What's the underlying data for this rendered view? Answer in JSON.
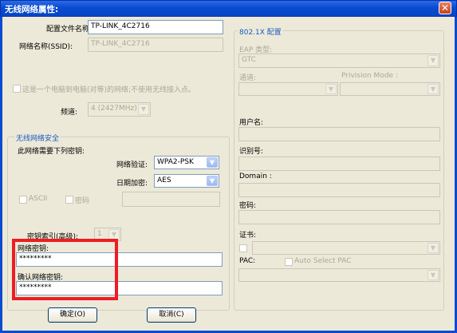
{
  "window": {
    "title": "无线网络属性:",
    "close_glyph": "✕"
  },
  "profile": {
    "config_name_label": "配置文件名称:",
    "config_name_value": "TP-LINK_4C2716",
    "ssid_label": "网络名称(SSID):",
    "ssid_value": "TP-LINK_4C2716"
  },
  "adhoc": {
    "label": "这是一个电脑到电脑(对等)的网络;不使用无线接入点。",
    "channel_label": "频道:",
    "channel_value": "4 (2427MHz)"
  },
  "security": {
    "group_title": "无线网络安全",
    "requires_key_label": "此网络需要下列密钥:",
    "auth_label": "网络验证:",
    "auth_value": "WPA2-PSK",
    "encryption_label": "日期加密:",
    "encryption_value": "AES",
    "ascii_label": "ASCII",
    "password_label": "密码",
    "key_index_label": "密钥索引(高级):",
    "key_index_value": "1",
    "net_key_label": "网络密钥:",
    "net_key_value": "*********",
    "confirm_key_label": "确认网络密钥:",
    "confirm_key_value": "*********"
  },
  "eap_8021x": {
    "group_title": "802.1X 配置",
    "eap_type_label": "EAP 类型:",
    "eap_type_value": "GTC",
    "tunnel_label": "通道:",
    "provision_label": "Privision Mode :",
    "username_label": "用户名:",
    "identity_label": "识别号:",
    "domain_label": "Domain :",
    "password_label": "密码:",
    "cert_label": "证书:",
    "pac_label": "PAC:",
    "auto_pac_label": "Auto Select PAC"
  },
  "buttons": {
    "ok": "确定(O)",
    "cancel": "取消(C)"
  },
  "colors": {
    "titlebar": "#0a4bd0",
    "dialog_bg": "#ece9d8",
    "highlight_box": "#ee1c24",
    "group_title": "#1c5ac4"
  }
}
